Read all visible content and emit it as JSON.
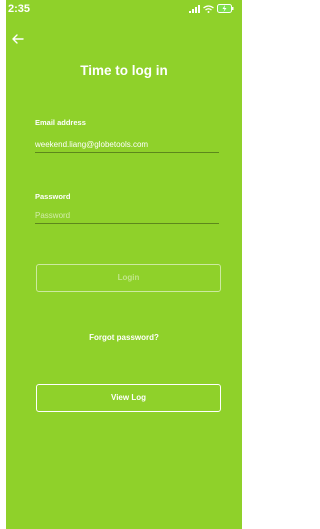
{
  "status_bar": {
    "time": "2:35",
    "signal_icon": "signal-icon",
    "wifi_icon": "wifi-icon",
    "battery_icon": "battery-charging-icon"
  },
  "header": {
    "back_icon": "arrow-left-icon",
    "title": "Time to log in"
  },
  "form": {
    "email_label": "Email address",
    "email_value": "weekend.liang@globetools.com",
    "password_label": "Password",
    "password_placeholder": "Password"
  },
  "actions": {
    "login_label": "Login",
    "forgot_label": "Forgot password?",
    "view_log_label": "View Log"
  },
  "colors": {
    "background": "#8fd12a",
    "text": "#ffffff",
    "battery": "#7ee04a"
  }
}
